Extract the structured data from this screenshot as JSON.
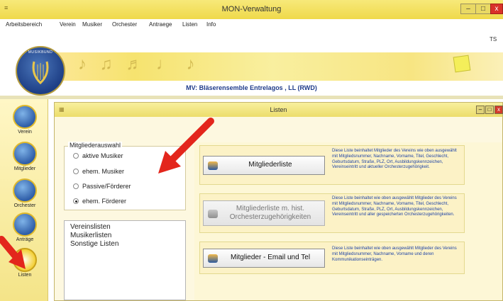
{
  "window": {
    "title": "MON-Verwaltung",
    "controls": {
      "min": "–",
      "max": "□",
      "close": "x"
    }
  },
  "menu": [
    "Arbeitsbereich",
    "Verein",
    "Musiker",
    "Orchester",
    "Antraege",
    "Listen",
    "Info"
  ],
  "header": {
    "user": "TS",
    "subtitle": "MV: Bläserensemble Entrelagos , LL (RWD)",
    "logo_text": "MUSIKBUND"
  },
  "nav": [
    {
      "label": "Verein",
      "icon": "verein-emblem-icon"
    },
    {
      "label": "Mitglieder",
      "icon": "mitglieder-emblem-icon"
    },
    {
      "label": "Orchester",
      "icon": "orchester-emblem-icon"
    },
    {
      "label": "Anträge",
      "icon": "antraege-emblem-icon"
    },
    {
      "label": "Listen",
      "icon": "listen-emblem-icon"
    }
  ],
  "inner_window": {
    "title": "Listen"
  },
  "member_selection": {
    "legend": "Mitgliederauswahl",
    "options": [
      {
        "label": "aktive Musiker",
        "checked": false
      },
      {
        "label": "ehem. Musiker",
        "checked": false
      },
      {
        "label": "Passive/Förderer",
        "checked": false
      },
      {
        "label": "ehem. Förderer",
        "checked": true
      }
    ]
  },
  "tree": [
    "Vereinslisten",
    "Musikerlisten",
    "Sonstige Listen"
  ],
  "actions": [
    {
      "button": "Mitgliederliste",
      "enabled": true,
      "description": "Diese Liste beinhaltet Mitglieder des Vereins wie oben ausgewählt mit Mitgliedsnummer, Nachname, Vorname, Titel, Geschlecht, Geburtsdatum, Straße, PLZ, Ort, Ausbildungskennzeichen, Vereinseintritt und aktueller Orchesterzugehörigkeit."
    },
    {
      "button": "Mitgliederliste m. hist. Orchesterzugehörigkeiten",
      "enabled": false,
      "description": "Diese Liste beinhaltet wie oben ausgewählt Mitglieder des Vereins mit Mitgliedsnummer, Nachname, Vorname, Titel, Geschlecht, Geburtsdatum, Straße, PLZ, Ort, Ausbildungskennzeichen, Vereinseintritt und aller gespeicherten Orchesterzugehörigkeiten."
    },
    {
      "button": "Mitglieder - Email und Tel",
      "enabled": true,
      "description": "Diese Liste beinhaltet wie oben ausgewählt Mitglieder des Vereins mit Mitgliedsnummer, Nachname, Vorname und deren Kommunikationseinträgen."
    }
  ],
  "colors": {
    "accent_yellow": "#f3e27a",
    "arrow_red": "#e3261c",
    "subtitle_blue": "#1f3b8a"
  }
}
